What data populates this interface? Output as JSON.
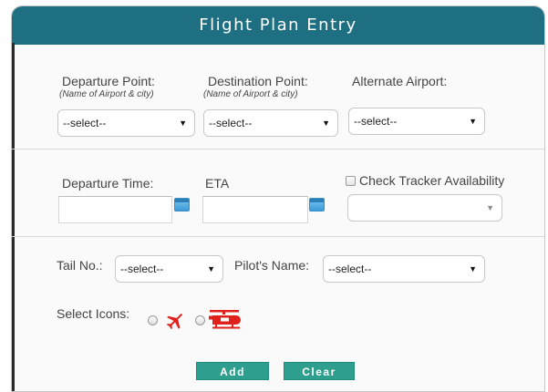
{
  "header": {
    "title": "Flight Plan Entry"
  },
  "route": {
    "departure": {
      "label": "Departure Point:",
      "sub": "(Name of Airport & city)",
      "value": "--select--"
    },
    "destination": {
      "label": "Destination Point:",
      "sub": "(Name of Airport & city)",
      "value": "--select--"
    },
    "alternate": {
      "label": "Alternate Airport:",
      "value": "--select--"
    }
  },
  "times": {
    "departure_label": "Departure Time:",
    "departure_value": "",
    "eta_label": "ETA",
    "eta_value": "",
    "tracker_label": "Check Tracker Availability",
    "tracker_checked": false,
    "tracker_value": ""
  },
  "crew": {
    "tail_label": "Tail No.:",
    "tail_value": "--select--",
    "pilot_label": "Pilot's Name:",
    "pilot_value": "--select--",
    "icons_label": "Select Icons:",
    "icon_options": [
      "airplane-icon",
      "helicopter-icon"
    ]
  },
  "actions": {
    "add_label": "Add",
    "clear_label": "Clear"
  },
  "colors": {
    "header": "#1f6f82",
    "button": "#2e9e8e",
    "icon": "#e0201b",
    "calendar": "#3a9bd9"
  }
}
